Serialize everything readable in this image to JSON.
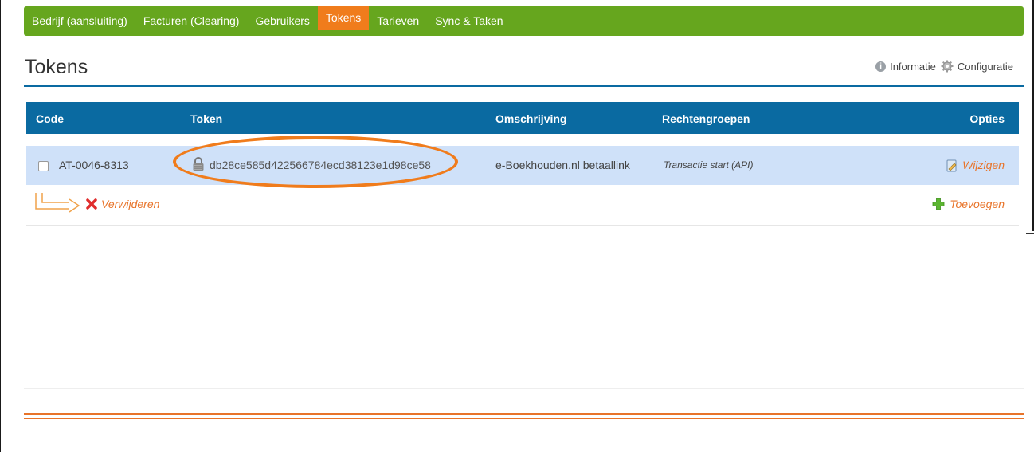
{
  "nav": {
    "items": [
      {
        "label": "Bedrijf (aansluiting)"
      },
      {
        "label": "Facturen (Clearing)"
      },
      {
        "label": "Gebruikers"
      },
      {
        "label": "Tokens",
        "active": true
      },
      {
        "label": "Tarieven"
      },
      {
        "label": "Sync & Taken"
      }
    ]
  },
  "page": {
    "title": "Tokens",
    "info_label": "Informatie",
    "config_label": "Configuratie"
  },
  "table": {
    "headers": {
      "code": "Code",
      "token": "Token",
      "omschrijving": "Omschrijving",
      "rechtengroepen": "Rechtengroepen",
      "opties": "Opties"
    },
    "rows": [
      {
        "code": "AT-0046-8313",
        "token": "db28ce585d422566784ecd38123e1d98ce58",
        "omschrijving": "e-Boekhouden.nl betaallink",
        "rechtengroepen": "Transactie start (API)",
        "edit_label": "Wijzigen"
      }
    ]
  },
  "actions": {
    "delete_label": "Verwijderen",
    "add_label": "Toevoegen"
  },
  "colors": {
    "nav_green": "#66a61e",
    "accent_orange": "#f07c1c",
    "table_blue": "#0a6aa1",
    "row_highlight": "#cfe1f9"
  },
  "icons": [
    "info-icon",
    "gear-icon",
    "lock-icon",
    "edit-icon",
    "delete-icon",
    "add-icon",
    "arrow-icon"
  ]
}
